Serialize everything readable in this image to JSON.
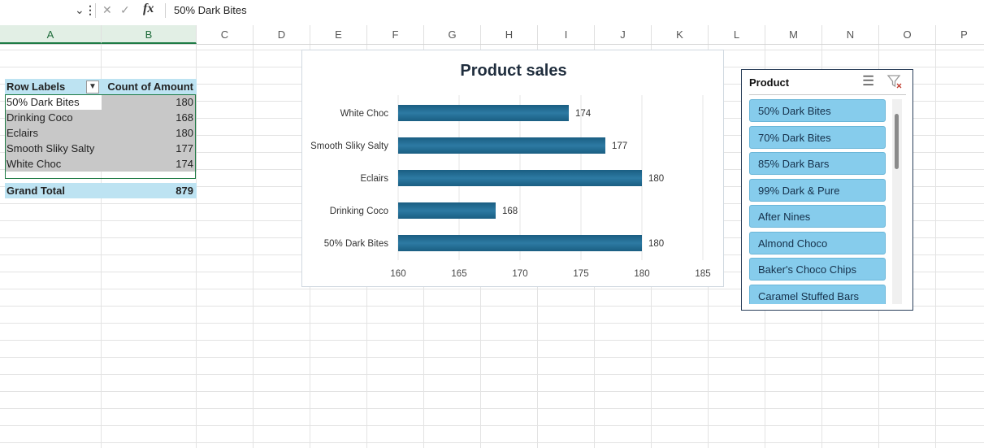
{
  "formula_bar": {
    "value": "50% Dark Bites",
    "fx_label": "fx",
    "cancel_glyph": "✕",
    "enter_glyph": "✓",
    "menu_glyph": "⋮",
    "dropdown_glyph": "⌄"
  },
  "columns": [
    "A",
    "B",
    "C",
    "D",
    "E",
    "F",
    "G",
    "H",
    "I",
    "J",
    "K",
    "L",
    "M",
    "N",
    "O",
    "P"
  ],
  "selected_columns": [
    "A",
    "B"
  ],
  "pivot": {
    "header_label": "Row Labels",
    "header_value": "Count of Amount",
    "filter_icon": "filter-icon",
    "rows": [
      {
        "label": "50% Dark Bites",
        "value": "180"
      },
      {
        "label": "Drinking Coco",
        "value": "168"
      },
      {
        "label": "Eclairs",
        "value": "180"
      },
      {
        "label": "Smooth Sliky Salty",
        "value": "177"
      },
      {
        "label": "White Choc",
        "value": "174"
      }
    ],
    "total_label": "Grand Total",
    "total_value": "879"
  },
  "chart_data": {
    "type": "bar",
    "orientation": "horizontal",
    "title": "Product sales",
    "categories": [
      "White Choc",
      "Smooth Sliky Salty",
      "Eclairs",
      "Drinking Coco",
      "50% Dark Bites"
    ],
    "values": [
      174,
      177,
      180,
      168,
      180
    ],
    "data_labels": [
      "174",
      "177",
      "180",
      "168",
      "180"
    ],
    "x_ticks": [
      "160",
      "165",
      "170",
      "175",
      "180",
      "185"
    ],
    "xlim": [
      160,
      185
    ],
    "grid": true,
    "bar_color": "#1a5e82",
    "bar_color_light": "#2d7aa3"
  },
  "slicer": {
    "title": "Product",
    "multiselect_icon": "multiselect-icon",
    "clear_filter_icon": "clear-filter-icon",
    "items": [
      "50% Dark Bites",
      "70% Dark Bites",
      "85% Dark Bars",
      "99% Dark & Pure",
      "After Nines",
      "Almond Choco",
      "Baker's Choco Chips",
      "Caramel Stuffed Bars"
    ],
    "item_color": "#86ccec"
  }
}
